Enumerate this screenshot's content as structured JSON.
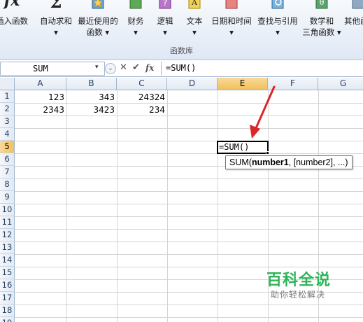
{
  "ribbon": {
    "buttons": [
      {
        "label1": "插入函数",
        "label2": "",
        "icon": "fx-icon"
      },
      {
        "label1": "自动求和",
        "label2": "▾",
        "icon": "sigma-icon"
      },
      {
        "label1": "最近使用的",
        "label2": "函数 ▾",
        "icon": "star-book-icon"
      },
      {
        "label1": "财务",
        "label2": "▾",
        "icon": "finance-book-icon"
      },
      {
        "label1": "逻辑",
        "label2": "▾",
        "icon": "logic-book-icon"
      },
      {
        "label1": "文本",
        "label2": "▾",
        "icon": "text-book-icon"
      },
      {
        "label1": "日期和时间",
        "label2": "▾",
        "icon": "calendar-book-icon"
      },
      {
        "label1": "查找与引用",
        "label2": "▾",
        "icon": "lookup-book-icon"
      },
      {
        "label1": "数学和",
        "label2": "三角函数 ▾",
        "icon": "math-book-icon"
      },
      {
        "label1": "其他函",
        "label2": "",
        "icon": "more-functions-icon"
      }
    ],
    "group_label": "函数库",
    "fx_glyph": "fx",
    "sigma_glyph": "Σ"
  },
  "formula_bar": {
    "name_box": "SUM",
    "dropdown_glyph": "▾",
    "expand_glyph": "⌄",
    "cancel_glyph": "✕",
    "enter_glyph": "✔",
    "fx_glyph": "fx",
    "formula": "=SUM()"
  },
  "grid": {
    "columns": [
      "A",
      "B",
      "C",
      "D",
      "E",
      "F",
      "G"
    ],
    "active_column": "E",
    "rows": [
      "1",
      "2",
      "3",
      "4",
      "5",
      "6",
      "7",
      "8",
      "9",
      "10",
      "11",
      "12",
      "13",
      "14",
      "15",
      "16",
      "17",
      "18",
      "19"
    ],
    "active_row": "5",
    "cells": {
      "A1": "123",
      "B1": "343",
      "C1": "24324",
      "A2": "2343",
      "B2": "3423",
      "C2": "234"
    },
    "active_cell_value": "=SUM()",
    "tooltip": {
      "func": "SUM(",
      "arg1": "number1",
      "rest": ", [number2], ...)"
    }
  },
  "colors": {
    "active_header": "#f1c05a",
    "arrow": "#d9262b",
    "watermark": "#2db45a"
  },
  "watermark": {
    "title": "百科全说",
    "subtitle": "助你轻松解决"
  }
}
